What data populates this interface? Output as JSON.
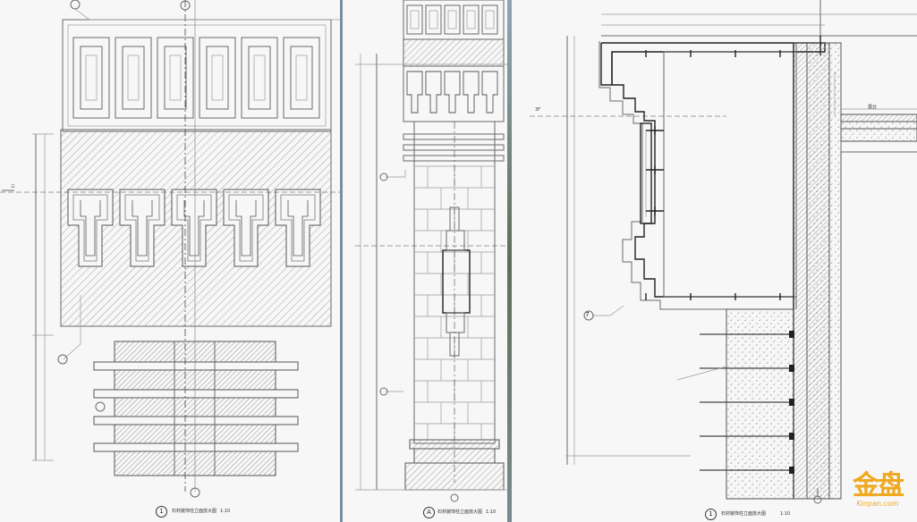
{
  "panels": {
    "left": {
      "caption_number": "1",
      "caption_text": "石材装饰柱立面放大图",
      "caption_scale": "1:10",
      "level_tag": "三"
    },
    "middle": {
      "caption_number": "A",
      "caption_text": "石材装饰柱立面放大图",
      "caption_scale": "1:10"
    },
    "right": {
      "caption_number": "1",
      "caption_text": "石材装饰柱立面放大图",
      "caption_scale": "1:10",
      "level_tag": "3F",
      "room_label": "露台",
      "callout_number": "7"
    }
  },
  "watermark": {
    "glyph": "金盘",
    "url": "Kinpan.com",
    "color": "#f0a81e"
  },
  "colors": {
    "background": "#6e7680",
    "sheet": "#f7f7f7",
    "line": "#6a6a6a"
  }
}
